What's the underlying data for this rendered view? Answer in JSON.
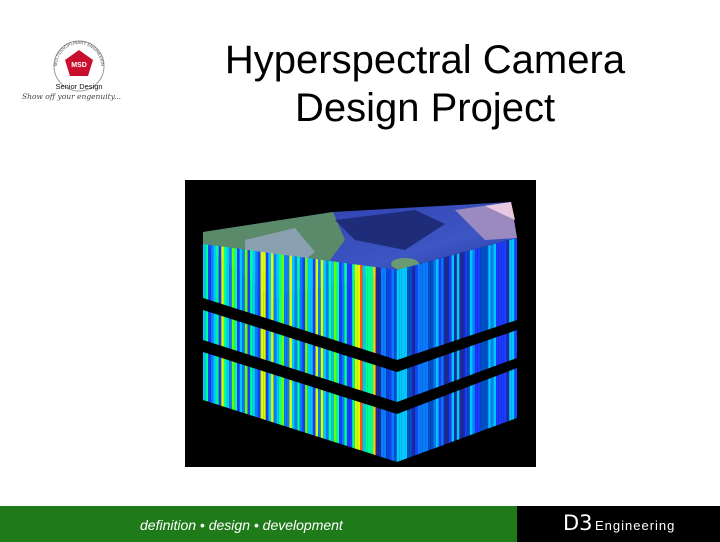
{
  "logo": {
    "emblem_ring_text": "MULTIDISCIPLINARY ENGINEERING AT RIT",
    "emblem_center": "MSD",
    "label": "Senior Design",
    "tagline": "Show off your engenuity..."
  },
  "slide": {
    "title_line1": "Hyperspectral Camera",
    "title_line2": "Design Project"
  },
  "footer": {
    "tagline": "definition • design • development",
    "brand_mark": "D3",
    "brand_word": "Engineering"
  },
  "colors": {
    "footer_green": "#1f7a1a",
    "footer_black": "#000000",
    "logo_red": "#c8102e"
  }
}
